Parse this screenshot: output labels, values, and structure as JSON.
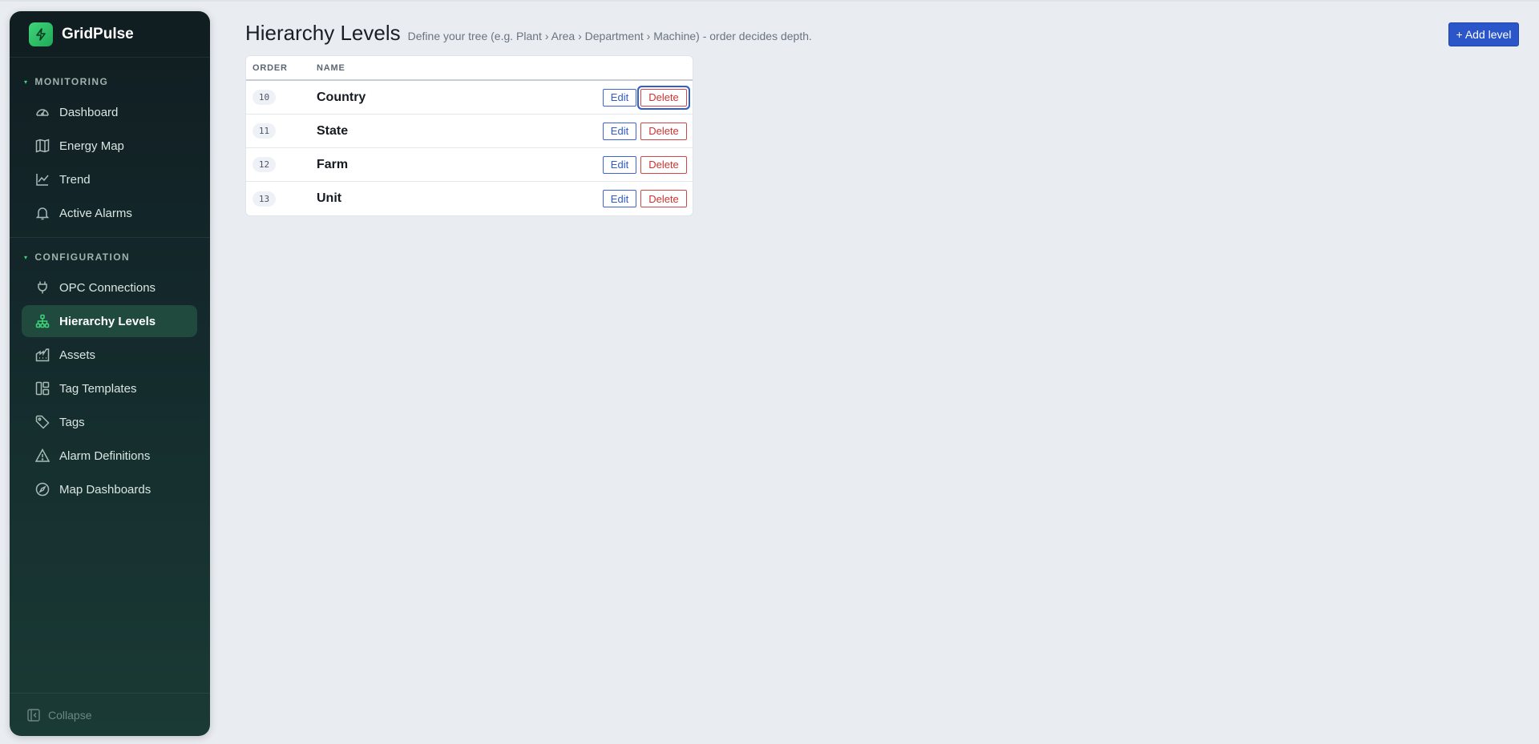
{
  "app": {
    "name": "GridPulse"
  },
  "sidebar": {
    "sections": [
      {
        "label": "MONITORING"
      },
      {
        "label": "CONFIGURATION"
      }
    ],
    "monitoring_items": [
      {
        "label": "Dashboard",
        "icon": "gauge-icon"
      },
      {
        "label": "Energy Map",
        "icon": "map-icon"
      },
      {
        "label": "Trend",
        "icon": "trend-line-icon"
      },
      {
        "label": "Active Alarms",
        "icon": "bell-icon"
      }
    ],
    "configuration_items": [
      {
        "label": "OPC Connections",
        "icon": "plug-icon"
      },
      {
        "label": "Hierarchy Levels",
        "icon": "hierarchy-icon",
        "active": true
      },
      {
        "label": "Assets",
        "icon": "factory-icon"
      },
      {
        "label": "Tag Templates",
        "icon": "layout-template-icon"
      },
      {
        "label": "Tags",
        "icon": "tag-icon"
      },
      {
        "label": "Alarm Definitions",
        "icon": "warning-triangle-icon"
      },
      {
        "label": "Map Dashboards",
        "icon": "compass-icon"
      }
    ],
    "collapse_label": "Collapse"
  },
  "header": {
    "title": "Hierarchy Levels",
    "subtitle": "Define your tree (e.g. Plant › Area › Department › Machine) - order decides depth."
  },
  "toolbar": {
    "add_label": "+ Add level"
  },
  "table": {
    "columns": [
      "ORDER",
      "NAME"
    ],
    "rows": [
      {
        "order": "10",
        "name": "Country"
      },
      {
        "order": "11",
        "name": "State"
      },
      {
        "order": "12",
        "name": "Farm"
      },
      {
        "order": "13",
        "name": "Unit"
      }
    ],
    "edit_label": "Edit",
    "delete_label": "Delete"
  },
  "colors": {
    "accent": "#2a56c9",
    "brand": "#3fd57a",
    "danger": "#cc3333",
    "sidebar_bg": "#122528"
  }
}
